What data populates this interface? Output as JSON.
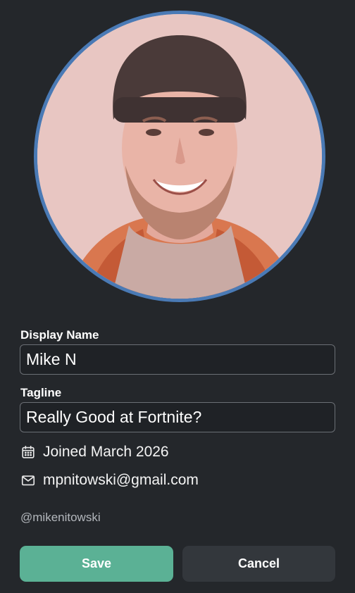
{
  "profile": {
    "avatar_alt": "Profile photo",
    "ring_color": "#4a7ab5"
  },
  "form": {
    "display_name_label": "Display Name",
    "display_name_value": "Mike N",
    "tagline_label": "Tagline",
    "tagline_value": "Really Good at Fortnite?"
  },
  "info": {
    "joined": {
      "icon": "calendar-icon",
      "text": "Joined March 2026"
    },
    "email": {
      "icon": "mail-icon",
      "text": "mpnitowski@gmail.com"
    },
    "handle": "@mikenitowski"
  },
  "actions": {
    "save_label": "Save",
    "cancel_label": "Cancel",
    "save_color": "#5bb195",
    "cancel_color": "#33373c"
  }
}
